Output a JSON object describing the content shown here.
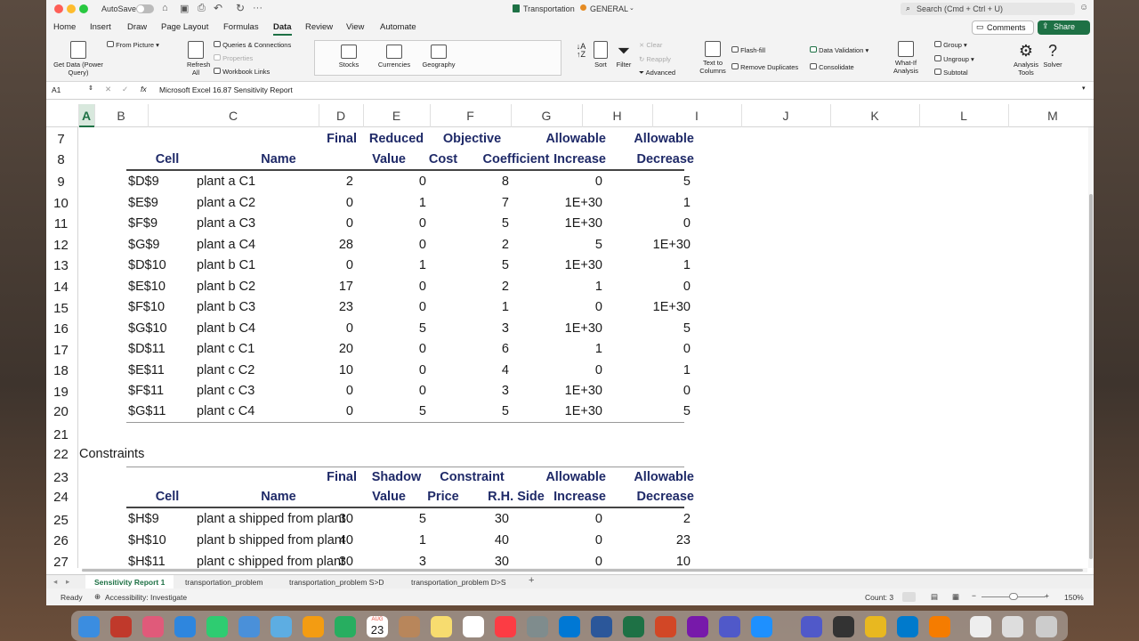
{
  "titlebar": {
    "autosave_label": "AutoSave",
    "doc_title": "Transportation",
    "sensitivity_label": "GENERAL",
    "search_placeholder": "Search (Cmd + Ctrl + U)"
  },
  "ribbon_tabs": [
    "Home",
    "Insert",
    "Draw",
    "Page Layout",
    "Formulas",
    "Data",
    "Review",
    "View",
    "Automate"
  ],
  "active_tab": "Data",
  "buttons": {
    "comments": "Comments",
    "share": "Share"
  },
  "ribbon": {
    "get_data": "Get Data (Power Query)",
    "from_picture": "From Picture",
    "refresh_all": "Refresh All",
    "queries": "Queries & Connections",
    "properties": "Properties",
    "workbook_links": "Workbook Links",
    "stocks": "Stocks",
    "currencies": "Currencies",
    "geography": "Geography",
    "sort": "Sort",
    "filter": "Filter",
    "clear": "Clear",
    "reapply": "Reapply",
    "advanced": "Advanced",
    "text_to_columns": "Text to Columns",
    "flash_fill": "Flash-fill",
    "remove_duplicates": "Remove Duplicates",
    "data_validation": "Data Validation",
    "consolidate": "Consolidate",
    "what_if": "What-If Analysis",
    "group": "Group",
    "ungroup": "Ungroup",
    "subtotal": "Subtotal",
    "analysis_tools": "Analysis Tools",
    "solver": "Solver"
  },
  "formula_bar": {
    "name_box": "A1",
    "fx": "fx",
    "formula": "Microsoft Excel 16.87 Sensitivity Report"
  },
  "columns": [
    "A",
    "B",
    "C",
    "D",
    "E",
    "F",
    "G",
    "H",
    "I",
    "J",
    "K",
    "L",
    "M"
  ],
  "rows": [
    "7",
    "8",
    "9",
    "10",
    "11",
    "12",
    "13",
    "14",
    "15",
    "16",
    "17",
    "18",
    "19",
    "20",
    "21",
    "22",
    "23",
    "24",
    "25",
    "26",
    "27"
  ],
  "variable_table": {
    "headers_top": [
      "Final",
      "Reduced",
      "Objective",
      "Allowable",
      "Allowable"
    ],
    "headers_bottom": [
      "Cell",
      "Name",
      "Value",
      "Cost",
      "Coefficient",
      "Increase",
      "Decrease"
    ],
    "rows": [
      [
        "$D$9",
        "plant a C1",
        "2",
        "0",
        "8",
        "0",
        "5"
      ],
      [
        "$E$9",
        "plant a C2",
        "0",
        "1",
        "7",
        "1E+30",
        "1"
      ],
      [
        "$F$9",
        "plant a C3",
        "0",
        "0",
        "5",
        "1E+30",
        "0"
      ],
      [
        "$G$9",
        "plant a C4",
        "28",
        "0",
        "2",
        "5",
        "1E+30"
      ],
      [
        "$D$10",
        "plant b C1",
        "0",
        "1",
        "5",
        "1E+30",
        "1"
      ],
      [
        "$E$10",
        "plant b C2",
        "17",
        "0",
        "2",
        "1",
        "0"
      ],
      [
        "$F$10",
        "plant b C3",
        "23",
        "0",
        "1",
        "0",
        "1E+30"
      ],
      [
        "$G$10",
        "plant b C4",
        "0",
        "5",
        "3",
        "1E+30",
        "5"
      ],
      [
        "$D$11",
        "plant c C1",
        "20",
        "0",
        "6",
        "1",
        "0"
      ],
      [
        "$E$11",
        "plant c C2",
        "10",
        "0",
        "4",
        "0",
        "1"
      ],
      [
        "$F$11",
        "plant c C3",
        "0",
        "0",
        "3",
        "1E+30",
        "0"
      ],
      [
        "$G$11",
        "plant c C4",
        "0",
        "5",
        "5",
        "1E+30",
        "5"
      ]
    ]
  },
  "constraints_title": "Constraints",
  "constraint_table": {
    "headers_top": [
      "Final",
      "Shadow",
      "Constraint",
      "Allowable",
      "Allowable"
    ],
    "headers_bottom": [
      "Cell",
      "Name",
      "Value",
      "Price",
      "R.H. Side",
      "Increase",
      "Decrease"
    ],
    "rows": [
      [
        "$H$9",
        "plant a shipped from plant",
        "30",
        "5",
        "30",
        "0",
        "2"
      ],
      [
        "$H$10",
        "plant b shipped from plant",
        "40",
        "1",
        "40",
        "0",
        "23"
      ],
      [
        "$H$11",
        "plant c shipped from plant",
        "30",
        "3",
        "30",
        "0",
        "10"
      ]
    ]
  },
  "sheet_tabs": [
    "Sensitivity Report 1",
    "transportation_problem",
    "transportation_problem S>D",
    "transportation_problem D>S"
  ],
  "active_sheet": "Sensitivity Report 1",
  "status": {
    "ready": "Ready",
    "accessibility": "Accessibility: Investigate",
    "count": "Count: 3",
    "zoom": "150%"
  },
  "dock_date": {
    "month": "AUG",
    "day": "23"
  },
  "colors": {
    "excel_green": "#1e7145",
    "header_navy": "#1f2a68"
  }
}
